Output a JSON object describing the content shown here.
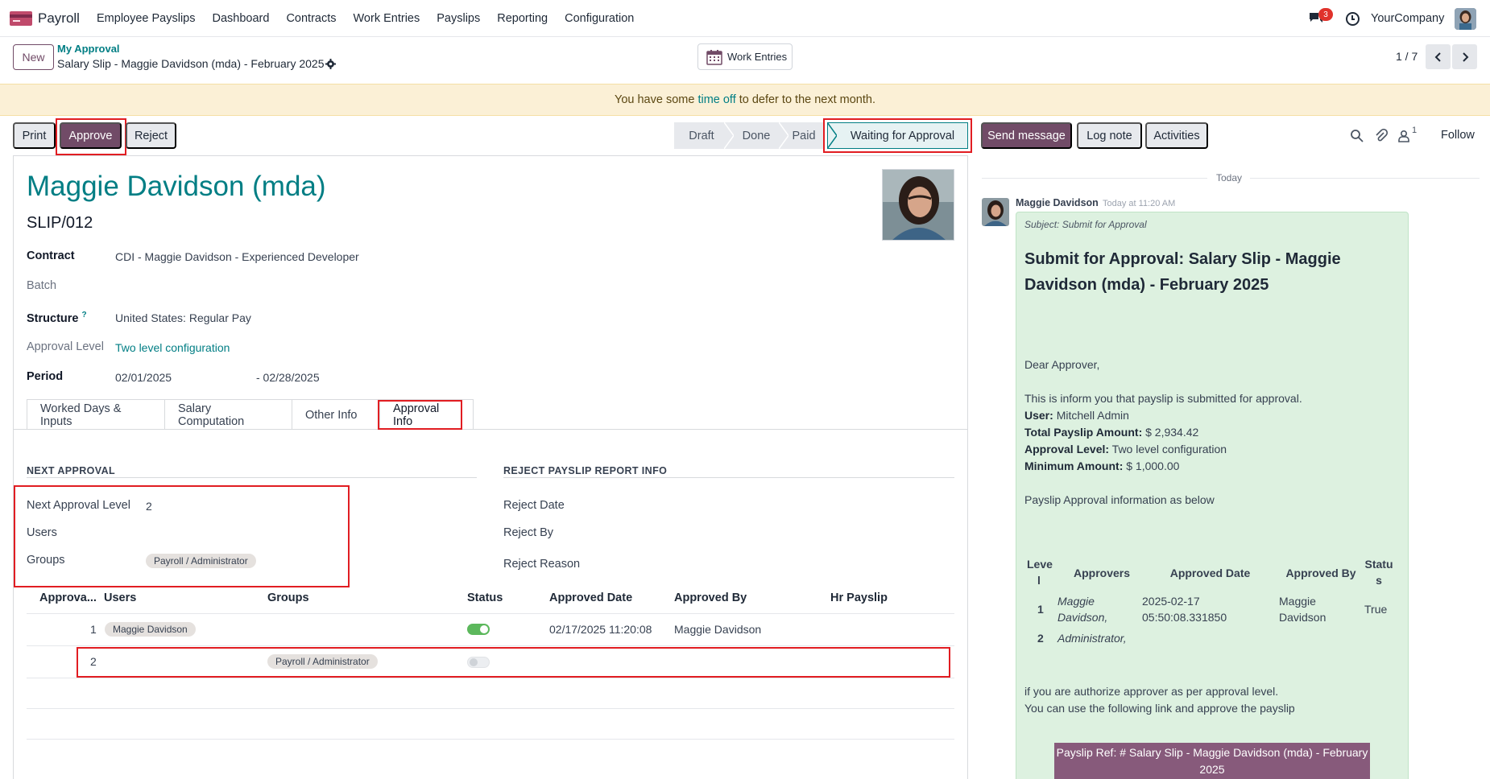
{
  "navbar": {
    "app_name": "Payroll",
    "menu": [
      "Employee Payslips",
      "Dashboard",
      "Contracts",
      "Work Entries",
      "Payslips",
      "Reporting",
      "Configuration"
    ],
    "message_count": "3",
    "company": "YourCompany"
  },
  "control_panel": {
    "new_label": "New",
    "breadcrumb_parent": "My Approval",
    "breadcrumb_current": "Salary Slip - Maggie Davidson (mda) - February 2025",
    "work_entries_label": "Work Entries",
    "pager": "1 / 7"
  },
  "banner": {
    "before": "You have some",
    "link": "time off",
    "after": "to defer to the next month."
  },
  "actions": {
    "print": "Print",
    "approve": "Approve",
    "reject": "Reject"
  },
  "stages": {
    "draft": "Draft",
    "done": "Done",
    "paid": "Paid",
    "waiting": "Waiting for Approval"
  },
  "chatter_buttons": {
    "send_message": "Send message",
    "log_note": "Log note",
    "activities": "Activities",
    "follower_count": "1",
    "follow": "Follow"
  },
  "form": {
    "employee_name": "Maggie Davidson (mda)",
    "slip_number": "SLIP/012",
    "fields": {
      "contract_label": "Contract",
      "contract_value": "CDI - Maggie Davidson - Experienced Developer",
      "batch_label": "Batch",
      "structure_label": "Structure",
      "structure_help": "?",
      "structure_value": "United States: Regular Pay",
      "approval_level_label": "Approval Level",
      "approval_level_value": "Two level configuration",
      "period_label": "Period",
      "period_from": "02/01/2025",
      "period_to": "- 02/28/2025"
    },
    "tabs": [
      "Worked Days & Inputs",
      "Salary Computation",
      "Other Info",
      "Approval Info"
    ]
  },
  "approval_info": {
    "next_approval_title": "NEXT APPROVAL",
    "next_level_label": "Next Approval Level",
    "next_level_value": "2",
    "users_label": "Users",
    "groups_label": "Groups",
    "groups_tag": "Payroll / Administrator",
    "reject_title": "REJECT PAYSLIP REPORT INFO",
    "reject_date_label": "Reject Date",
    "reject_by_label": "Reject By",
    "reject_reason_label": "Reject Reason",
    "table_headers": [
      "Approva...",
      "Users",
      "Groups",
      "Status",
      "Approved Date",
      "Approved By",
      "Hr Payslip"
    ],
    "rows": [
      {
        "level": "1",
        "user": "Maggie Davidson",
        "group": "",
        "status_on": true,
        "approved_date": "02/17/2025 11:20:08",
        "approved_by": "Maggie Davidson"
      },
      {
        "level": "2",
        "user": "",
        "group": "Payroll / Administrator",
        "status_on": false,
        "approved_date": "",
        "approved_by": ""
      }
    ]
  },
  "chatter": {
    "day_separator": "Today",
    "author": "Maggie Davidson",
    "time": "Today at 11:20 AM",
    "subject": "Subject: Submit for Approval",
    "title": "Submit for Approval: Salary Slip - Maggie Davidson (mda) - February 2025",
    "greeting": "Dear Approver,",
    "intro": "This is inform you that payslip is submitted for approval.",
    "user_label": "User:",
    "user_value": "Mitchell Admin",
    "total_label": "Total Payslip Amount:",
    "total_value": "$ 2,934.42",
    "level_label": "Approval Level:",
    "level_value": "Two level configuration",
    "min_label": "Minimum Amount:",
    "min_value": "$ 1,000.00",
    "info_line": "Payslip Approval information as below",
    "table_headers": {
      "level_a": "Leve",
      "level_b": "l",
      "approvers": "Approvers",
      "approved_date": "Approved Date",
      "approved_by": "Approved By",
      "status_a": "Statu",
      "status_b": "s"
    },
    "table_rows": [
      {
        "level": "1",
        "approvers_a": "Maggie",
        "approvers_b": "Davidson,",
        "date_a": "2025-02-17",
        "date_b": "05:50:08.331850",
        "by_a": "Maggie",
        "by_b": "Davidson",
        "status": "True"
      },
      {
        "level": "2",
        "approvers_a": "Administrator,",
        "approvers_b": "",
        "date_a": "",
        "date_b": "",
        "by_a": "",
        "by_b": "",
        "status": ""
      }
    ],
    "footer_1": "if you are authorize approver as per approval level.",
    "footer_2": "You can use the following link and approve the payslip",
    "ref_button_a": "Payslip Ref: # Salary Slip - Maggie Davidson (mda) - February",
    "ref_button_b": "2025"
  },
  "colors": {
    "brand": "#714b67",
    "link": "#017e84",
    "highlight": "#e11d22",
    "toggle_on": "#5cb85c",
    "banner_bg": "#fbf0d6",
    "message_bg": "#ddf1e0"
  }
}
